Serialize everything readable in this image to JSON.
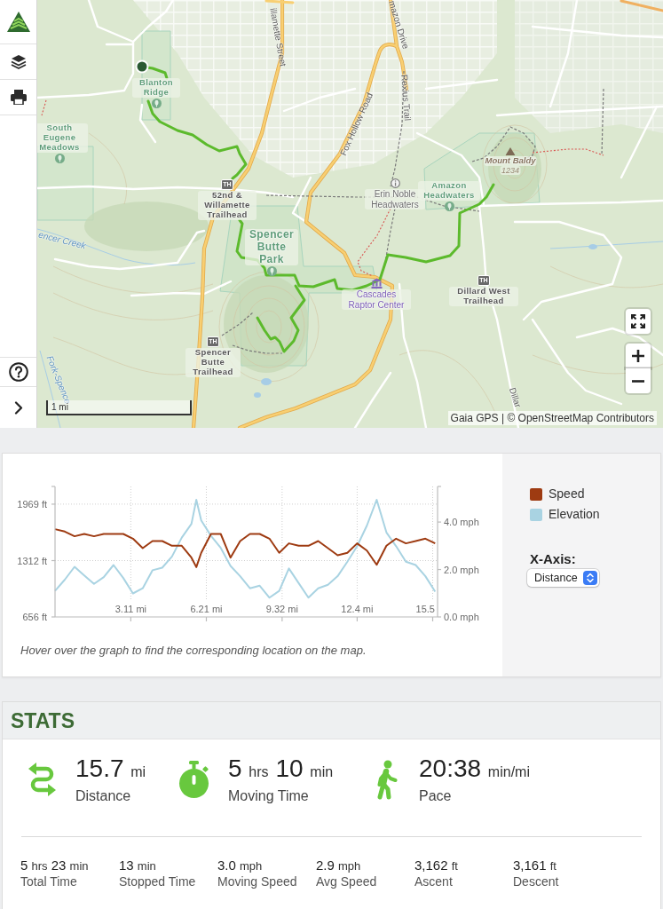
{
  "map": {
    "places": [
      {
        "name": "Blanton Ridge",
        "kind": "park"
      },
      {
        "name": "South Eugene Meadows",
        "kind": "park"
      },
      {
        "name": "Mount Baldy",
        "kind": "peak",
        "elevation": "1234"
      },
      {
        "name": "52nd & Willamette Trailhead",
        "kind": "trailhead",
        "marker": "TH"
      },
      {
        "name": "Erin Noble Headwaters",
        "kind": "info"
      },
      {
        "name": "Amazon Headwaters",
        "kind": "park"
      },
      {
        "name": "Spencer Butte Park",
        "kind": "park"
      },
      {
        "name": "Cascades Raptor Center",
        "kind": "museum"
      },
      {
        "name": "Dillard West Trailhead",
        "kind": "trailhead",
        "marker": "TH"
      },
      {
        "name": "Spencer Butte Trailhead",
        "kind": "trailhead",
        "marker": "TH"
      }
    ],
    "streets": [
      {
        "name": "illamette Street",
        "kind": "road"
      },
      {
        "name": "mazon Drive",
        "kind": "road"
      },
      {
        "name": "Rexius Trail",
        "kind": "road"
      },
      {
        "name": "Fox Hollow Road",
        "kind": "road"
      },
      {
        "name": "encer Creek",
        "kind": "water"
      },
      {
        "name": "Fork-Spence",
        "kind": "water"
      },
      {
        "name": "Dillar",
        "kind": "road"
      }
    ],
    "scale": "1 mi",
    "attribution": "Gaia GPS | © OpenStreetMap Contributors"
  },
  "chart": {
    "chart_data": {
      "type": "line",
      "grid": true,
      "x": [
        0,
        0.4,
        0.8,
        1.2,
        1.6,
        2,
        2.4,
        2.8,
        3.2,
        3.6,
        4,
        4.4,
        4.8,
        5.2,
        5.6,
        5.8,
        6,
        6.4,
        6.8,
        7.2,
        7.6,
        8,
        8.4,
        8.8,
        9.2,
        9.6,
        10,
        10.4,
        10.8,
        11.2,
        11.6,
        12,
        12.4,
        12.8,
        13.2,
        13.6,
        14,
        14.4,
        14.8,
        15.2,
        15.6
      ],
      "xlim": [
        0,
        15.7
      ],
      "ylim": [
        656,
        2175
      ],
      "y2lim": [
        0,
        5.5
      ],
      "xticks": [
        {
          "value": 3.11,
          "label": "3.11 mi"
        },
        {
          "value": 6.21,
          "label": "6.21 mi"
        },
        {
          "value": 9.32,
          "label": "9.32 mi"
        },
        {
          "value": 12.4,
          "label": "12.4 mi"
        },
        {
          "value": 15.5,
          "label": "15.5"
        }
      ],
      "yticks": [
        {
          "value": 656,
          "label": "656 ft"
        },
        {
          "value": 1312,
          "label": "1312 ft"
        },
        {
          "value": 1969,
          "label": "1969 ft"
        }
      ],
      "y2ticks": [
        {
          "value": 0,
          "label": "0.0 mph"
        },
        {
          "value": 2,
          "label": "2.0 mph"
        },
        {
          "value": 4,
          "label": "4.0 mph"
        }
      ],
      "series": [
        {
          "name": "Speed",
          "color": "#9e3b12",
          "axis": "y2",
          "values": [
            3.7,
            3.6,
            3.4,
            3.5,
            3.4,
            3.5,
            3.5,
            3.5,
            3.3,
            2.9,
            3.2,
            3.2,
            3.0,
            3.0,
            2.5,
            2.1,
            2.7,
            3.5,
            3.5,
            2.5,
            3.2,
            3.5,
            3.5,
            3.3,
            2.7,
            3.1,
            3.0,
            3.0,
            3.2,
            2.9,
            2.6,
            2.7,
            3.1,
            2.8,
            2.2,
            3.0,
            3.3,
            3.1,
            3.2,
            3.3,
            3.1
          ]
        },
        {
          "name": "Elevation",
          "color": "#a9d3e2",
          "values": [
            960,
            1090,
            1240,
            1140,
            1040,
            1120,
            1260,
            1110,
            930,
            990,
            1200,
            1230,
            1360,
            1580,
            1740,
            2020,
            1780,
            1600,
            1460,
            1250,
            1130,
            990,
            1020,
            880,
            960,
            1220,
            1050,
            880,
            990,
            1030,
            1130,
            1300,
            1480,
            1720,
            2020,
            1640,
            1480,
            1300,
            1260,
            1130,
            950
          ]
        }
      ]
    },
    "caption": "Hover over the graph to find the corresponding location on the map.",
    "x_axis_control": {
      "label": "X-Axis:",
      "value": "Distance"
    }
  },
  "stats": {
    "title": "STATS",
    "primary": [
      {
        "kind": "distance",
        "parts": [
          {
            "number": "15.7",
            "unit": "mi"
          }
        ],
        "label": "Distance"
      },
      {
        "kind": "moving_time",
        "parts": [
          {
            "number": "5",
            "unit": "hrs"
          },
          {
            "number": "10",
            "unit": "min"
          }
        ],
        "label": "Moving Time"
      },
      {
        "kind": "pace",
        "parts": [
          {
            "number": "20:38",
            "unit": "min/mi"
          }
        ],
        "label": "Pace"
      }
    ],
    "secondary": [
      {
        "parts": [
          {
            "number": "5",
            "unit": "hrs"
          },
          {
            "number": "23",
            "unit": "min"
          }
        ],
        "label": "Total Time"
      },
      {
        "parts": [
          {
            "number": "13",
            "unit": "min"
          }
        ],
        "label": "Stopped Time"
      },
      {
        "parts": [
          {
            "number": "3.0",
            "unit": "mph"
          }
        ],
        "label": "Moving Speed"
      },
      {
        "parts": [
          {
            "number": "2.9",
            "unit": "mph"
          }
        ],
        "label": "Avg Speed"
      },
      {
        "parts": [
          {
            "number": "3,162",
            "unit": "ft"
          }
        ],
        "label": "Ascent"
      },
      {
        "parts": [
          {
            "number": "3,161",
            "unit": "ft"
          }
        ],
        "label": "Descent"
      }
    ]
  }
}
